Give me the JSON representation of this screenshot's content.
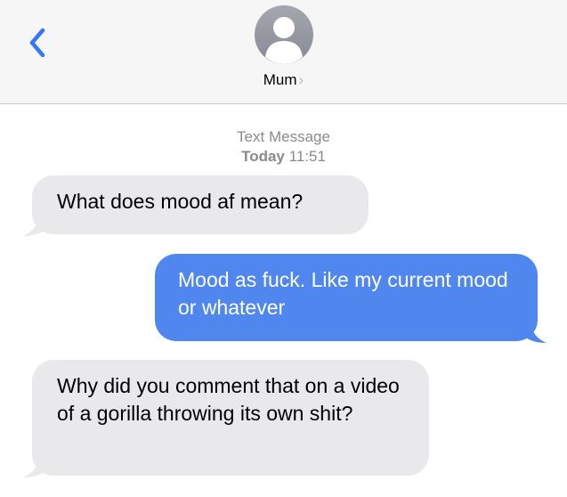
{
  "header": {
    "back_icon": "chevron-left-icon",
    "avatar_icon": "person-silhouette-icon",
    "contact_name": "Mum",
    "contact_chevron": "›"
  },
  "conversation": {
    "service": "Text Message",
    "day": "Today",
    "time": "11:51",
    "messages": [
      {
        "direction": "incoming",
        "text": "What does mood af mean?"
      },
      {
        "direction": "outgoing",
        "text": "Mood as fuck. Like my current mood or whatever"
      },
      {
        "direction": "incoming",
        "text": "Why did you comment that on a video of a gorilla throwing its own shit?"
      }
    ]
  },
  "colors": {
    "accent_blue": "#3478f6",
    "outgoing_bubble": "#4f87ef",
    "incoming_bubble": "#e9e9eb",
    "header_bg": "#f6f6f6",
    "meta_gray": "#8a8a8e"
  }
}
